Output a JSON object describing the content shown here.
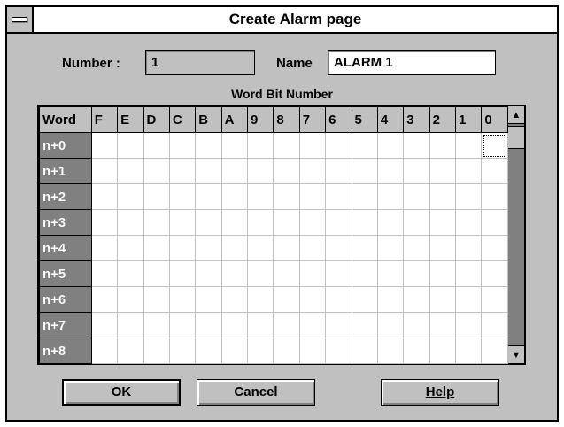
{
  "window": {
    "title": "Create Alarm page"
  },
  "form": {
    "number_label": "Number :",
    "number_value": "1",
    "name_label": "Name",
    "name_value": "ALARM 1"
  },
  "grid": {
    "section_label": "Word Bit Number",
    "corner_header": "Word",
    "bit_headers": [
      "F",
      "E",
      "D",
      "C",
      "B",
      "A",
      "9",
      "8",
      "7",
      "6",
      "5",
      "4",
      "3",
      "2",
      "1",
      "0"
    ],
    "rows": [
      "n+0",
      "n+1",
      "n+2",
      "n+3",
      "n+4",
      "n+5",
      "n+6",
      "n+7",
      "n+8"
    ]
  },
  "buttons": {
    "ok": "OK",
    "cancel": "Cancel",
    "help": "Help"
  },
  "icons": {
    "system_menu": "system-menu-icon",
    "scroll_up": "arrow-up-icon",
    "scroll_down": "arrow-down-icon"
  }
}
